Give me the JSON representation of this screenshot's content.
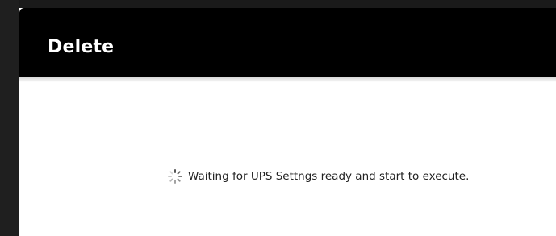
{
  "dialog": {
    "title": "Delete",
    "status_message": "Waiting for UPS Settngs ready and start to execute.",
    "status_icon": "loading-spinner-icon"
  },
  "colors": {
    "header_background": "#000000",
    "title_text": "#ffffff",
    "body_background": "#ffffff",
    "status_text": "#222222",
    "spinner_dots": "#9a9a9a"
  }
}
